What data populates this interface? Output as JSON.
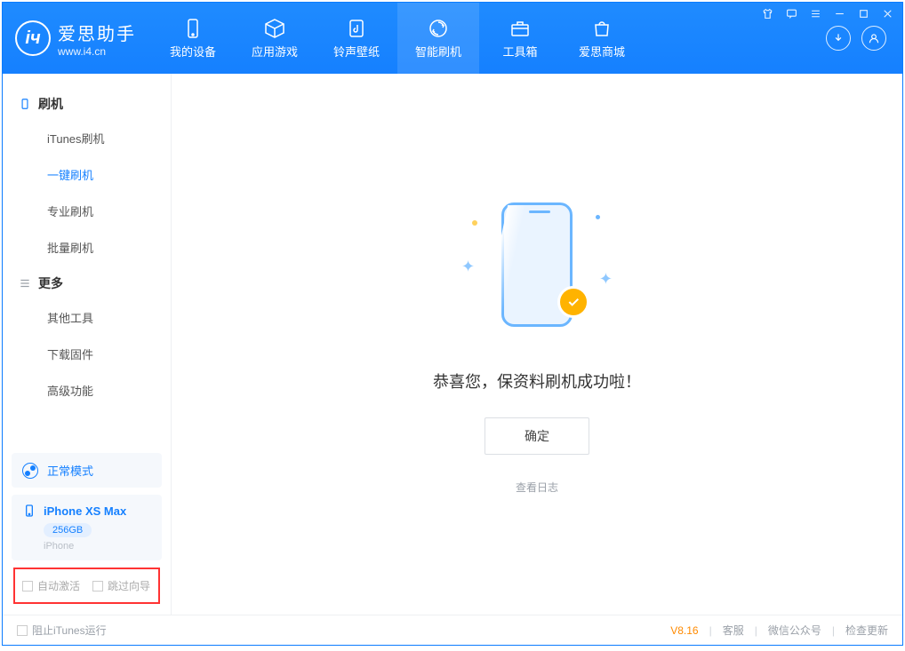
{
  "app": {
    "name": "爱思助手",
    "url": "www.i4.cn"
  },
  "nav": {
    "items": [
      {
        "label": "我的设备"
      },
      {
        "label": "应用游戏"
      },
      {
        "label": "铃声壁纸"
      },
      {
        "label": "智能刷机"
      },
      {
        "label": "工具箱"
      },
      {
        "label": "爱思商城"
      }
    ],
    "active_index": 3
  },
  "sidebar": {
    "sections": [
      {
        "title": "刷机",
        "items": [
          "iTunes刷机",
          "一键刷机",
          "专业刷机",
          "批量刷机"
        ],
        "selected_index": 1
      },
      {
        "title": "更多",
        "items": [
          "其他工具",
          "下载固件",
          "高级功能"
        ],
        "selected_index": -1
      }
    ],
    "mode": "正常模式",
    "device": {
      "name": "iPhone XS Max",
      "capacity": "256GB",
      "type": "iPhone"
    },
    "options": {
      "auto_activate": "自动激活",
      "skip_guide": "跳过向导"
    }
  },
  "main": {
    "message": "恭喜您，保资料刷机成功啦！",
    "ok": "确定",
    "view_log": "查看日志"
  },
  "footer": {
    "block_itunes": "阻止iTunes运行",
    "version": "V8.16",
    "links": [
      "客服",
      "微信公众号",
      "检查更新"
    ]
  }
}
